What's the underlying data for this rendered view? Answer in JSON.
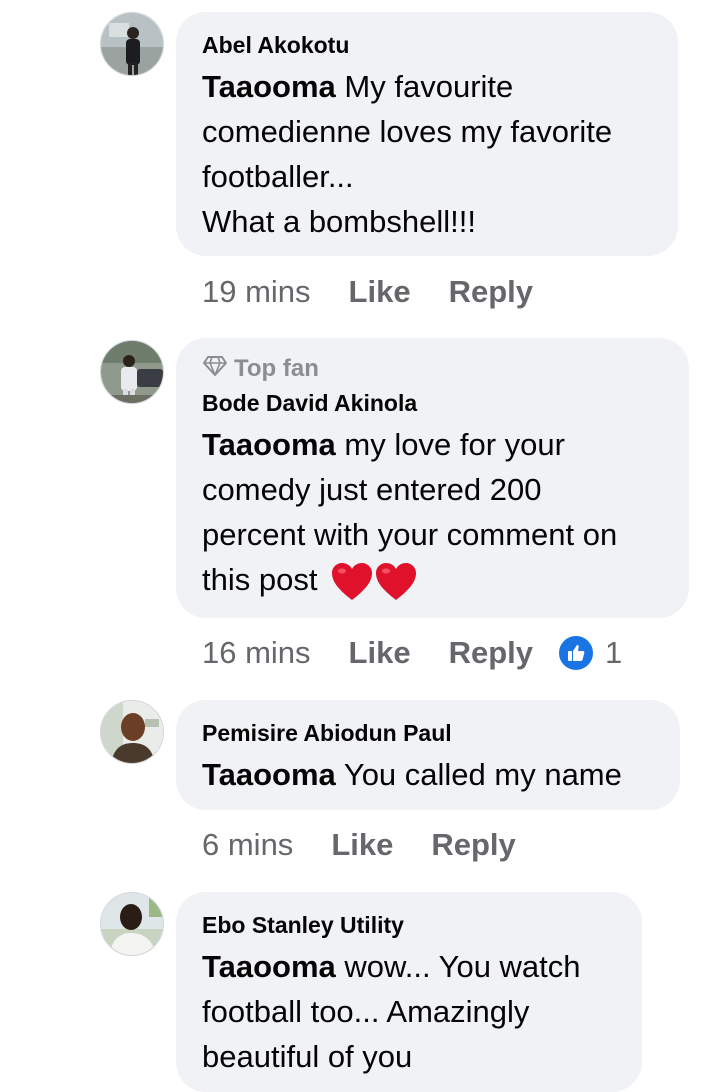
{
  "comments": [
    {
      "author": "Abel Akokotu",
      "badge": "",
      "mention": "Taaooma",
      "lines": [
        "My favourite",
        "comedienne loves my favorite",
        "footballer...",
        "What a bombshell!!!"
      ],
      "time": "19 mins",
      "like_label": "Like",
      "reply_label": "Reply",
      "reaction_count": ""
    },
    {
      "author": "Bode David Akinola",
      "badge": "Top fan",
      "mention": "Taaooma",
      "lines": [
        "my love for your",
        "comedy just entered 200",
        "percent with your comment on",
        "this post"
      ],
      "emoji": [
        "red-heart",
        "red-heart"
      ],
      "time": "16 mins",
      "like_label": "Like",
      "reply_label": "Reply",
      "reaction_count": "1"
    },
    {
      "author": "Pemisire Abiodun Paul",
      "badge": "",
      "mention": "Taaooma",
      "lines": [
        "You called my name"
      ],
      "time": "6 mins",
      "like_label": "Like",
      "reply_label": "Reply",
      "reaction_count": ""
    },
    {
      "author": "Ebo Stanley Utility",
      "badge": "",
      "mention": "Taaooma",
      "lines": [
        "wow... You watch",
        "football too... Amazingly",
        "beautiful of you"
      ],
      "time": "",
      "like_label": "",
      "reply_label": "",
      "reaction_count": ""
    }
  ],
  "icons": {
    "top_fan": "diamond-icon",
    "reaction": "thumbs-up-icon",
    "emoji": "red-heart-icon"
  },
  "colors": {
    "bubble": "#f0f2f5",
    "meta_text": "#65676b",
    "like_blue": "#1b74e4",
    "heart_red": "#e0112b"
  }
}
